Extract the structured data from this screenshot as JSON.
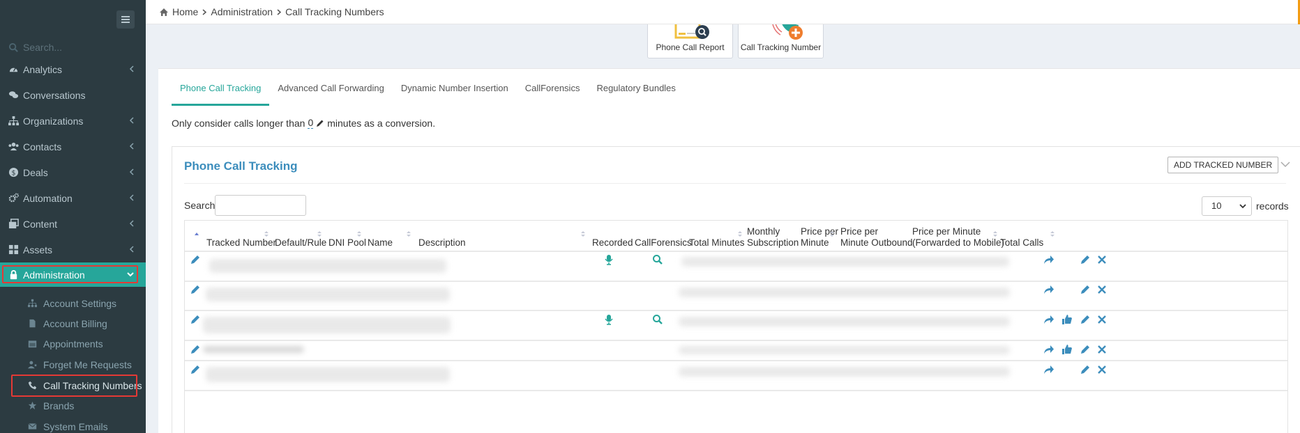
{
  "sidebar": {
    "search_placeholder": "Search...",
    "menu": [
      {
        "label": "Analytics",
        "icon": "dashboard-icon"
      },
      {
        "label": "Conversations",
        "icon": "comments-icon"
      },
      {
        "label": "Organizations",
        "icon": "sitemap-icon"
      },
      {
        "label": "Contacts",
        "icon": "users-icon"
      },
      {
        "label": "Deals",
        "icon": "dollar-circle-icon"
      },
      {
        "label": "Automation",
        "icon": "cogs-icon"
      },
      {
        "label": "Content",
        "icon": "clone-icon"
      },
      {
        "label": "Assets",
        "icon": "grid-icon"
      },
      {
        "label": "Administration",
        "icon": "lock-icon"
      }
    ],
    "submenu": [
      {
        "label": "Account Settings",
        "icon": "sitemap-icon"
      },
      {
        "label": "Account Billing",
        "icon": "file-icon"
      },
      {
        "label": "Appointments",
        "icon": "calendar-icon"
      },
      {
        "label": "Forget Me Requests",
        "icon": "user-times-icon"
      },
      {
        "label": "Call Tracking Numbers",
        "icon": "phone-icon"
      },
      {
        "label": "Brands",
        "icon": "star-icon"
      },
      {
        "label": "System Emails",
        "icon": "envelope-icon"
      }
    ]
  },
  "breadcrumb": {
    "home": "Home",
    "level1": "Administration",
    "level2": "Call Tracking Numbers"
  },
  "tiles": {
    "report": "Phone Call Report",
    "tracking": "Call Tracking Number"
  },
  "tabs": [
    "Phone Call Tracking",
    "Advanced Call Forwarding",
    "Dynamic Number Insertion",
    "CallForensics",
    "Regulatory Bundles"
  ],
  "conversion": {
    "prefix": "Only consider calls longer than",
    "value": "0",
    "suffix": "minutes as a conversion."
  },
  "panel": {
    "title": "Phone Call Tracking",
    "add_button": "ADD TRACKED NUMBER",
    "search_label": "Search:",
    "page_size": "10",
    "records_label": "records"
  },
  "table": {
    "headers": {
      "tracked": "Tracked Number",
      "default": "Default/Rule",
      "dni": "DNI Pool",
      "name": "Name",
      "description": "Description",
      "recorded": "Recorded",
      "callforensics": "CallForensics",
      "total_minutes": "Total Minutes",
      "monthly_1": "Monthly",
      "monthly_2": "Subscription",
      "ppm_1": "Price per",
      "ppm_2": "Minute",
      "ppmo_1": "Price per",
      "ppmo_2": "Minute Outbound",
      "ppmf_1": "Price per Minute",
      "ppmf_2": "(Forwarded to Mobile)",
      "total_calls": "Total Calls"
    },
    "rows": [
      {
        "recorded": true,
        "forensics": true,
        "thumb": false
      },
      {
        "recorded": false,
        "forensics": false,
        "thumb": false
      },
      {
        "recorded": true,
        "forensics": true,
        "thumb": true
      },
      {
        "recorded": false,
        "forensics": false,
        "thumb": true
      },
      {
        "recorded": false,
        "forensics": false,
        "thumb": false
      }
    ]
  },
  "colors": {
    "sidebar_bg": "#2c3b41",
    "active_green": "#26a69a",
    "link_blue": "#3c8dbc",
    "highlight_red": "#e53935"
  }
}
